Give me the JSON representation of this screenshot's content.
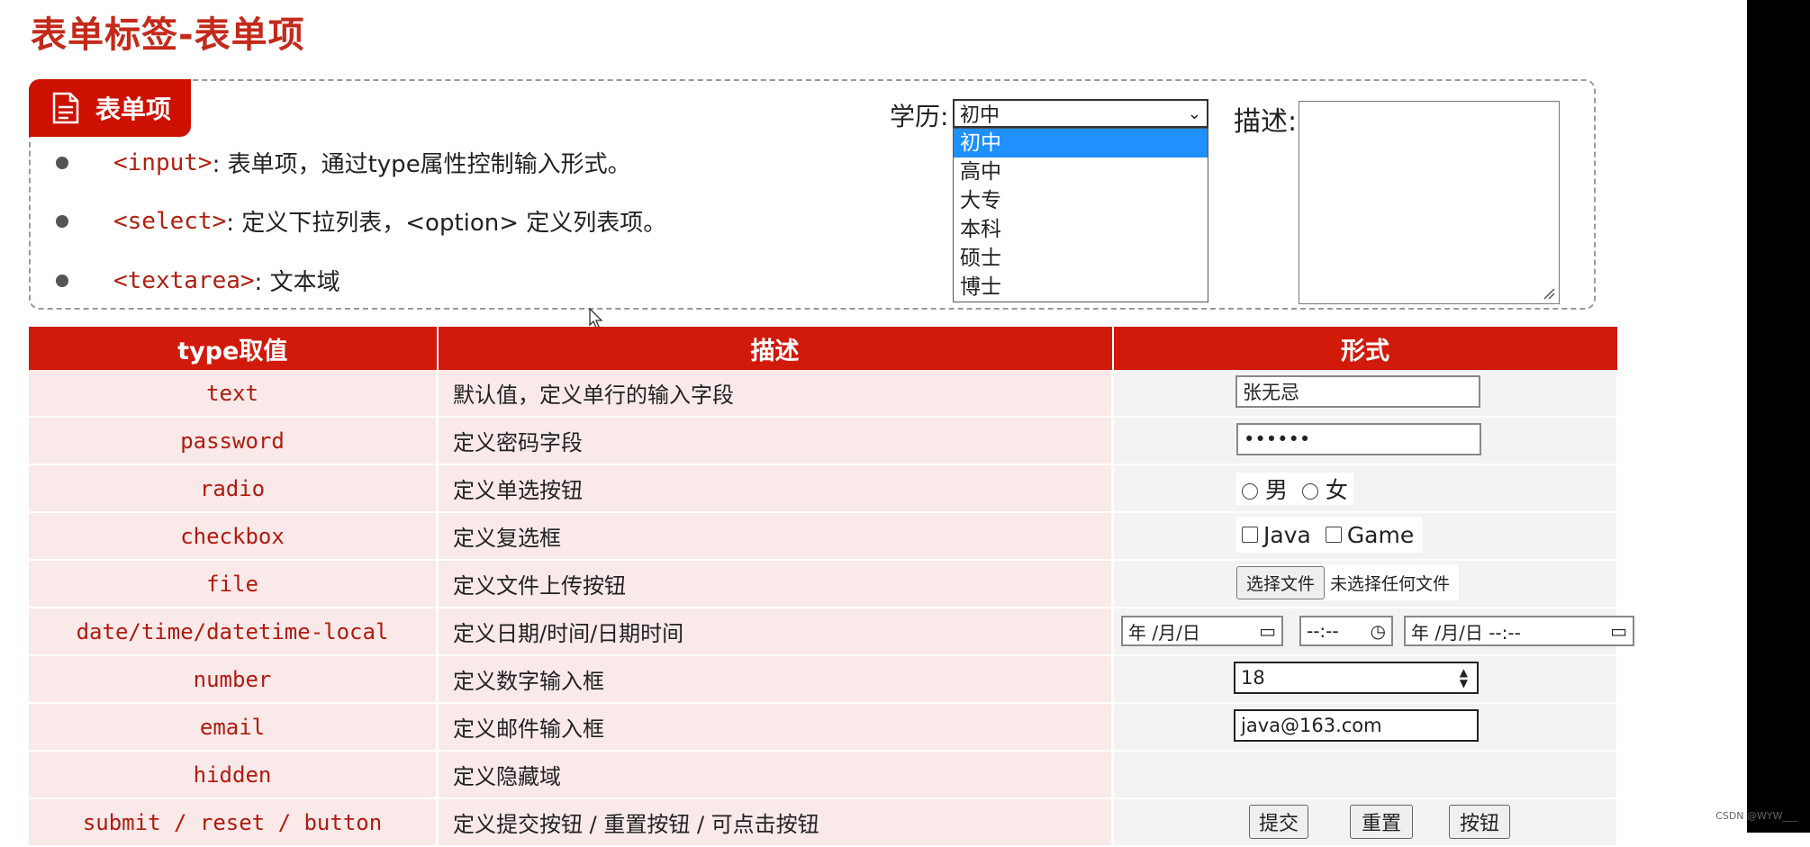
{
  "page_title": "表单标签-表单项",
  "panel": {
    "tag_label": "表单项",
    "bullets": [
      {
        "tag": "<input>",
        "desc": ": 表单项，通过type属性控制输入形式。"
      },
      {
        "tag": "<select>",
        "desc": ": 定义下拉列表，<option> 定义列表项。"
      },
      {
        "tag": "<textarea>",
        "desc": ": 文本域"
      }
    ],
    "select_demo": {
      "label": "学历:",
      "selected": "初中",
      "options": [
        "初中",
        "高中",
        "大专",
        "本科",
        "硕士",
        "博士"
      ]
    },
    "textarea_demo": {
      "label": "描述:"
    }
  },
  "table": {
    "headers": [
      "type取值",
      "描述",
      "形式"
    ],
    "rows": [
      {
        "type": "text",
        "desc": "默认值，定义单行的输入字段"
      },
      {
        "type": "password",
        "desc": "定义密码字段"
      },
      {
        "type": "radio",
        "desc": "定义单选按钮"
      },
      {
        "type": "checkbox",
        "desc": "定义复选框"
      },
      {
        "type": "file",
        "desc": "定义文件上传按钮"
      },
      {
        "type": "date/time/datetime-local",
        "desc": "定义日期/时间/日期时间"
      },
      {
        "type": "number",
        "desc": "定义数字输入框"
      },
      {
        "type": "email",
        "desc": "定义邮件输入框"
      },
      {
        "type": "hidden",
        "desc": "定义隐藏域"
      },
      {
        "type": "submit / reset / button",
        "desc": "定义提交按钮 / 重置按钮 / 可点击按钮"
      }
    ],
    "demos": {
      "text_value": "张无忌",
      "password_value": "••••••",
      "radio_options": [
        "男",
        "女"
      ],
      "checkbox_options": [
        "Java",
        "Game"
      ],
      "file_button": "选择文件",
      "file_status": "未选择任何文件",
      "date_value": "年 /月/日",
      "time_value": "--:--",
      "datetime_value": "年 /月/日 --:--",
      "number_value": "18",
      "email_value": "java@163.com",
      "buttons": [
        "提交",
        "重置",
        "按钮"
      ]
    }
  },
  "watermark": "CSDN @WYW___"
}
